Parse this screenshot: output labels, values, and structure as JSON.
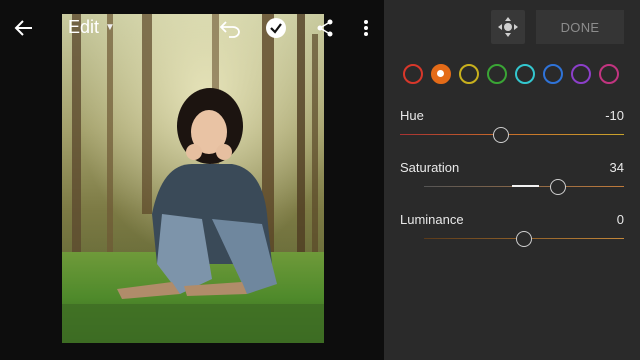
{
  "header": {
    "edit_label": "Edit",
    "back_icon": "back-arrow-icon",
    "undo_icon": "undo-icon",
    "confirm_icon": "checkmark-icon",
    "share_icon": "share-icon",
    "more_icon": "more-vertical-icon"
  },
  "panel": {
    "target_icon": "targeted-adjustment-icon",
    "done_label": "DONE",
    "color_swatches": [
      {
        "name": "red",
        "color": "#d8372a",
        "selected": false
      },
      {
        "name": "orange",
        "color": "#e46b18",
        "selected": true
      },
      {
        "name": "yellow",
        "color": "#c8b01d",
        "selected": false
      },
      {
        "name": "green",
        "color": "#3aa535",
        "selected": false
      },
      {
        "name": "aqua",
        "color": "#33c7cf",
        "selected": false
      },
      {
        "name": "blue",
        "color": "#2f73d8",
        "selected": false
      },
      {
        "name": "purple",
        "color": "#8c3fc9",
        "selected": false
      },
      {
        "name": "magenta",
        "color": "#c23480",
        "selected": false
      }
    ],
    "sliders": [
      {
        "label": "Hue",
        "value": "-10",
        "value_fraction": 0.45
      },
      {
        "label": "Saturation",
        "value": "34",
        "value_fraction": 0.67
      },
      {
        "label": "Luminance",
        "value": "0",
        "value_fraction": 0.5
      }
    ]
  }
}
